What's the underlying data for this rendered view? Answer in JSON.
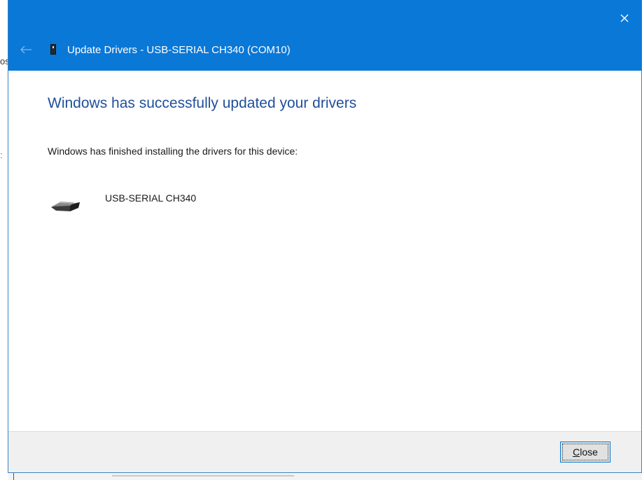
{
  "background": {
    "fragment_1": "os",
    "fragment_2": ":"
  },
  "dialog": {
    "title": "Update Drivers - USB-SERIAL CH340 (COM10)",
    "heading": "Windows has successfully updated your drivers",
    "message": "Windows has finished installing the drivers for this device:",
    "device_name": "USB-SERIAL CH340",
    "close_button": {
      "mnemonic": "C",
      "rest": "lose"
    }
  },
  "colors": {
    "titlebar": "#0a78d7",
    "heading": "#1f4f9c",
    "button_border": "#0078d7"
  },
  "icons": {
    "window_close": "close-icon",
    "back": "back-arrow-icon",
    "device_small": "usb-device-icon",
    "device_large": "usb-serial-device-icon"
  }
}
